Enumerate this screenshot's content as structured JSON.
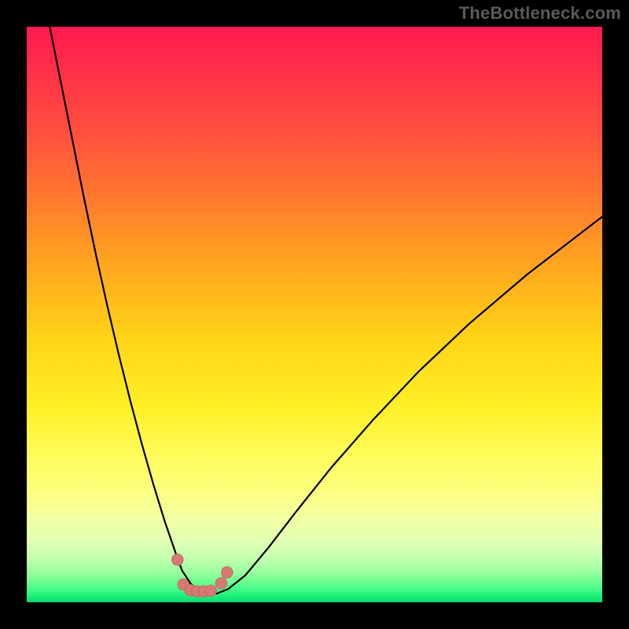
{
  "watermark": "TheBottleneck.com",
  "colors": {
    "frame_bg": "#000000",
    "curve": "#000000",
    "marker_fill": "#d77a74",
    "marker_stroke": "#c46863",
    "watermark": "#5a5a5a"
  },
  "chart_data": {
    "type": "line",
    "title": "",
    "xlabel": "",
    "ylabel": "",
    "xlim": [
      0,
      100
    ],
    "ylim": [
      0,
      100
    ],
    "grid": false,
    "legend": false,
    "series": [
      {
        "name": "bottleneck-curve",
        "x": [
          4,
          6,
          8,
          10,
          12,
          14,
          16,
          18,
          20,
          22,
          24,
          26,
          27,
          28.5,
          30,
          31.5,
          33,
          35,
          38,
          42,
          47,
          53,
          60,
          68,
          77,
          87,
          100
        ],
        "values": [
          100,
          90,
          80,
          70,
          60.5,
          51.5,
          43,
          35,
          27.5,
          20.5,
          14,
          8.2,
          5.5,
          3.2,
          2.0,
          1.5,
          1.5,
          2.3,
          4.7,
          9.5,
          16,
          23.5,
          31.5,
          40,
          48.5,
          57,
          67
        ]
      }
    ],
    "markers": {
      "name": "floor-markers",
      "x": [
        26.2,
        27.2,
        28.4,
        29.6,
        30.8,
        32.0,
        33.8,
        34.8
      ],
      "values": [
        7.4,
        3.1,
        2.1,
        1.9,
        1.9,
        2.0,
        3.3,
        5.2
      ]
    }
  }
}
